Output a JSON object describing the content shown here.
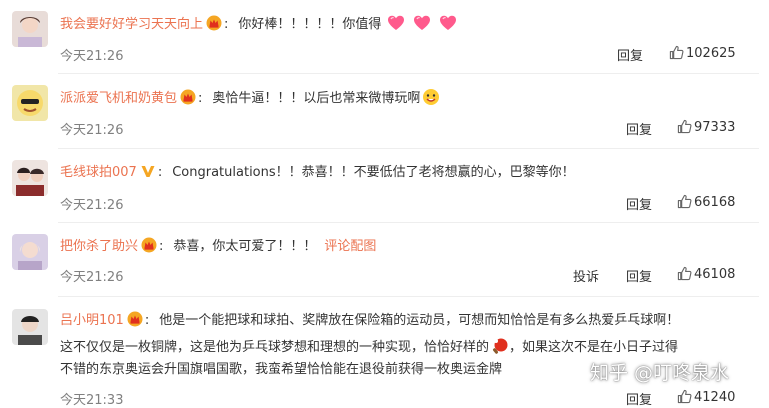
{
  "comments": [
    {
      "user": "我会要好好学习天天向上",
      "colon": ":",
      "text": "你好棒！！！！！你值得",
      "time": "今天21:26",
      "reply_label": "回复",
      "likes": "102625"
    },
    {
      "user": "派派爱飞机和奶黄包",
      "colon": ":",
      "text": "奥恰牛逼！！！以后也常来微博玩啊",
      "time": "今天21:26",
      "reply_label": "回复",
      "likes": "97333"
    },
    {
      "user": "毛线球拍007",
      "colon": ":",
      "text": "Congratulations！！恭喜！！不要低估了老将想赢的心，巴黎等你！",
      "time": "今天21:26",
      "reply_label": "回复",
      "likes": "66168"
    },
    {
      "user": "把你杀了助兴",
      "colon": ":",
      "text": "恭喜，你太可爱了！！！",
      "link": "评论配图",
      "time": "今天21:26",
      "report_label": "投诉",
      "reply_label": "回复",
      "likes": "46108"
    },
    {
      "user": "吕小明101",
      "colon": ":",
      "text": "他是一个能把球和球拍、奖牌放在保险箱的运动员，可想而知恰恰是有多么热爱乒乓球啊！",
      "line2a": "这不仅仅是一枚铜牌，这是他为乒乓球梦想和理想的一种实现，恰恰好样的",
      "line2b": "，如果这次不是在小日子过得",
      "line3": "不错的东京奥运会升国旗唱国歌，我蛮希望恰恰能在退役前获得一枚奥运金牌",
      "time": "今天21:33",
      "reply_label": "回复",
      "likes": "41240"
    }
  ],
  "watermark": "知乎 @叮咚泉水",
  "colors": {
    "username": "#eb7350",
    "text": "#333333",
    "time": "#808080",
    "separator": "#eeeeee"
  },
  "icons": [
    "vip-crown-icon",
    "thumbs-up-icon",
    "heart-emoji-icon",
    "smiley-emoji-icon",
    "pingpong-emoji-icon",
    "v-badge-icon"
  ]
}
